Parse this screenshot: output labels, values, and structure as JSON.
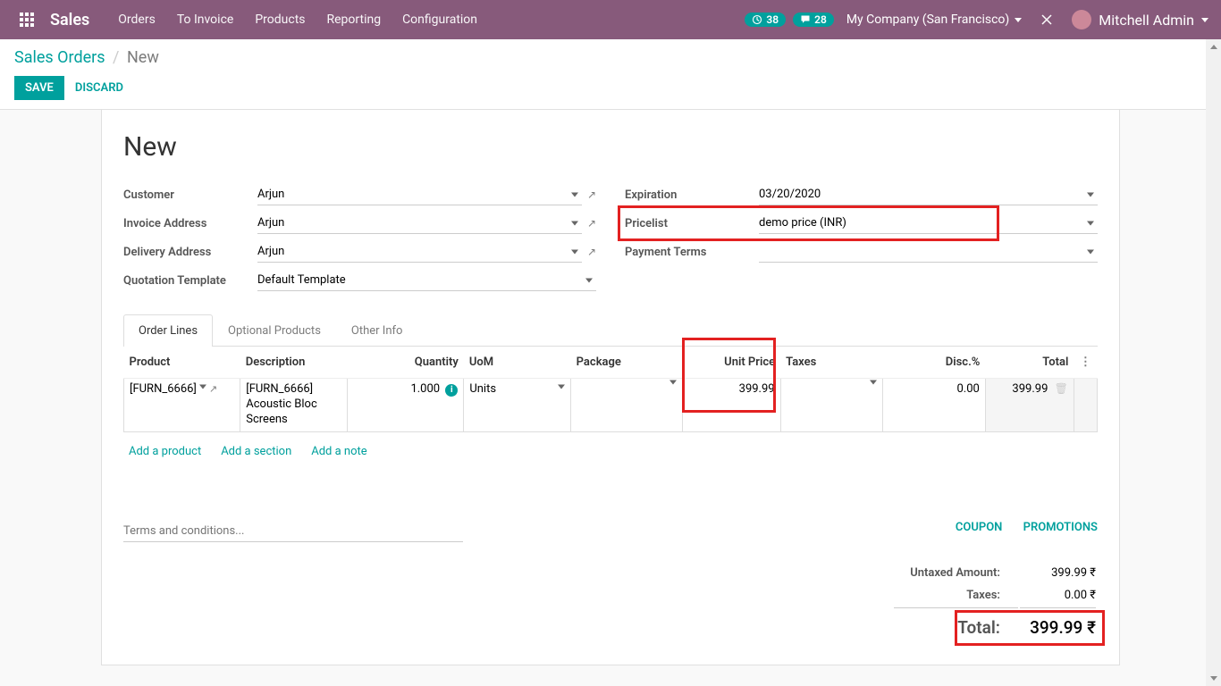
{
  "navbar": {
    "brand": "Sales",
    "menu": [
      "Orders",
      "To Invoice",
      "Products",
      "Reporting",
      "Configuration"
    ],
    "activity_count": "38",
    "chat_count": "28",
    "company": "My Company (San Francisco)",
    "user": "Mitchell Admin"
  },
  "breadcrumb": {
    "root": "Sales Orders",
    "current": "New"
  },
  "buttons": {
    "save": "SAVE",
    "discard": "DISCARD"
  },
  "page_title": "New",
  "form": {
    "customer_label": "Customer",
    "customer_value": "Arjun",
    "invoice_addr_label": "Invoice Address",
    "invoice_addr_value": "Arjun",
    "delivery_addr_label": "Delivery Address",
    "delivery_addr_value": "Arjun",
    "quote_tmpl_label": "Quotation Template",
    "quote_tmpl_value": "Default Template",
    "expiration_label": "Expiration",
    "expiration_value": "03/20/2020",
    "pricelist_label": "Pricelist",
    "pricelist_value": "demo price (INR)",
    "payment_terms_label": "Payment Terms",
    "payment_terms_value": ""
  },
  "tabs": {
    "order_lines": "Order Lines",
    "optional_products": "Optional Products",
    "other_info": "Other Info"
  },
  "table_headers": {
    "product": "Product",
    "description": "Description",
    "quantity": "Quantity",
    "uom": "UoM",
    "package": "Package",
    "unit_price": "Unit Price",
    "taxes": "Taxes",
    "disc": "Disc.%",
    "total": "Total"
  },
  "order_line": {
    "product": "[FURN_6666] A",
    "description": "[FURN_6666] Acoustic Bloc Screens",
    "quantity": "1.000",
    "uom": "Units",
    "package": "",
    "unit_price": "399.99",
    "taxes": "",
    "disc": "0.00",
    "total": "399.99"
  },
  "table_links": {
    "add_product": "Add a product",
    "add_section": "Add a section",
    "add_note": "Add a note"
  },
  "terms_placeholder": "Terms and conditions...",
  "promo": {
    "coupon": "COUPON",
    "promotions": "PROMOTIONS"
  },
  "totals": {
    "untaxed_label": "Untaxed Amount:",
    "untaxed_value": "399.99 ₹",
    "taxes_label": "Taxes:",
    "taxes_value": "0.00 ₹",
    "total_label": "Total:",
    "total_value": "399.99 ₹"
  }
}
